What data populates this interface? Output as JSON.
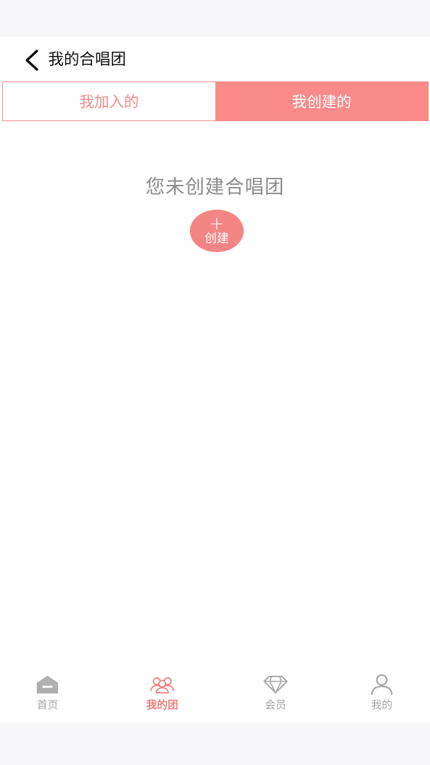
{
  "header": {
    "title": "我的合唱团",
    "back_icon": "chevron-left-icon"
  },
  "tabs": [
    {
      "label": "我加入的",
      "active": false
    },
    {
      "label": "我创建的",
      "active": true
    }
  ],
  "empty_state": {
    "message": "您未创建合唱团",
    "create_plus": "+",
    "create_label": "创建"
  },
  "bottom_nav": [
    {
      "label": "首页",
      "icon": "home-icon",
      "active": false
    },
    {
      "label": "我的团",
      "icon": "group-icon",
      "active": true
    },
    {
      "label": "会员",
      "icon": "diamond-icon",
      "active": false
    },
    {
      "label": "我的",
      "icon": "user-icon",
      "active": false
    }
  ],
  "colors": {
    "accent": "#fb8a8a",
    "accent_text": "#ef8b8b",
    "muted_text": "#8c8c8c",
    "nav_inactive": "#a3a3a3"
  }
}
